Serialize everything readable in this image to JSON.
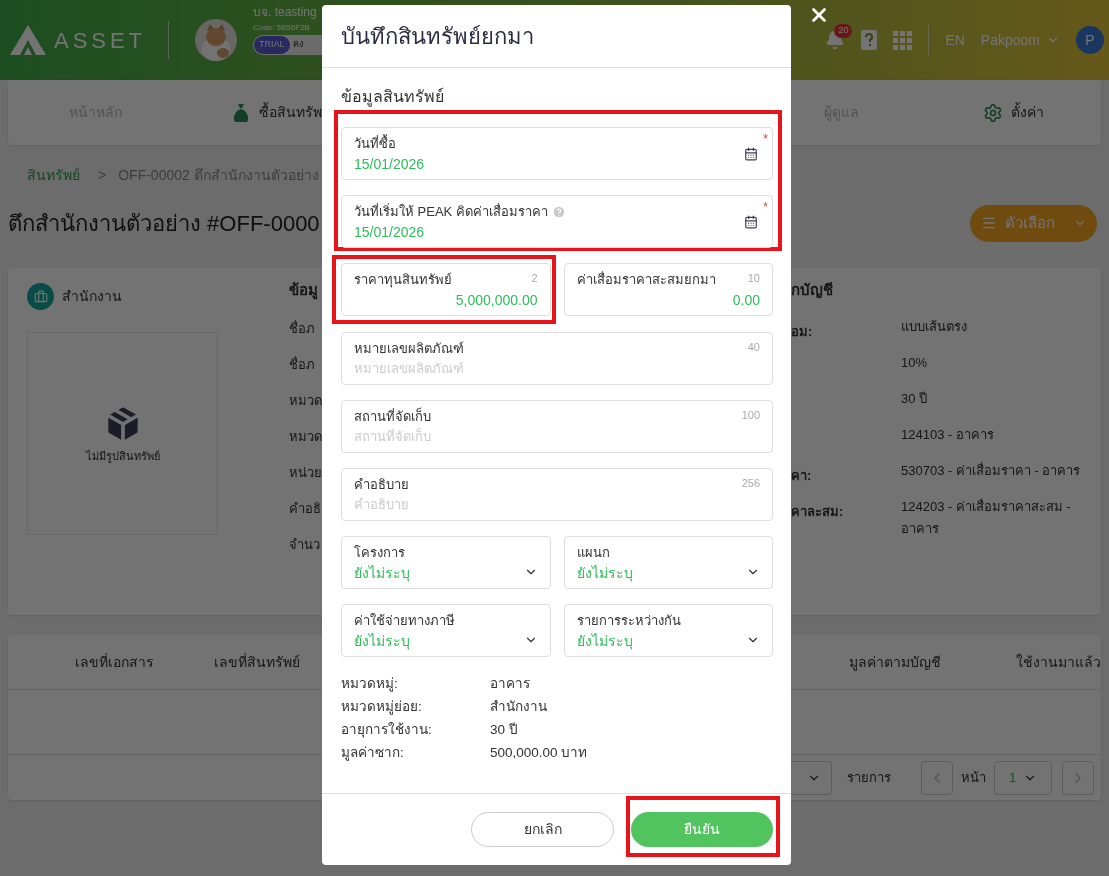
{
  "header": {
    "logo": "ASSET",
    "company": "บจ. teasting",
    "code": "Code: 5B56F2B",
    "badge": "TRIAL",
    "badge_note": "คง",
    "notifications": "20",
    "language": "EN",
    "user": "Pakpoom",
    "avatar": "P"
  },
  "nav": [
    {
      "label": "หน้าหลัก",
      "dimmed": true,
      "kind": "plain"
    },
    {
      "label": "ซื้อสินทรัพ",
      "dimmed": false,
      "kind": "money"
    },
    {
      "label": "ผู้ดูแล",
      "dimmed": true,
      "kind": "plain"
    },
    {
      "label": "ตั้งค่า",
      "dimmed": false,
      "kind": "settings"
    }
  ],
  "breadcrumb": {
    "link": "สินทรัพย์",
    "separator": ">",
    "current": "OFF-00002 ตึกสำนักงานตัวอย่าง"
  },
  "title": "ตึกสำนักงานตัวอย่าง #OFF-0000",
  "options_button": "ตัวเลือก",
  "asset_card": {
    "category": "สำนักงาน",
    "no_image": "ไม่มีรูปสินทรัพย์",
    "info_heading": "ข้อมู",
    "info_labels": [
      "ชื่อภ",
      "ชื่อภ",
      "หมวด",
      "หมวด",
      "หน่วย",
      "คำอธิ",
      "จำนว"
    ],
    "accounting_heading": "กบัญชี",
    "accounting_rows": [
      {
        "label": "อม:",
        "value": "แบบเส้นตรง"
      },
      {
        "value": "10%"
      },
      {
        "value": "30 ปี"
      },
      {
        "value": "124103 - อาคาร"
      },
      {
        "label": "คา:",
        "value": "530703 - ค่าเสื่อมราคา - อาคาร"
      },
      {
        "label": "คาละสม:",
        "value": "124203 - ค่าเสื่อมราคาสะสม - อาคาร"
      }
    ]
  },
  "history_table": {
    "columns_left": [
      "เลขที่เอกสาร",
      "เลขที่สินทรัพย์"
    ],
    "columns_right": [
      "มูลค่าตามบัญชี",
      "ใช้งานมาแล้ว"
    ],
    "rows_label": "รายการ",
    "page_label": "หน้า",
    "page": "1"
  },
  "modal": {
    "title": "บันทึกสินทรัพย์ยกมา",
    "section": "ข้อมูลสินทรัพย์",
    "date_group": {
      "highlighted": true,
      "fields": [
        {
          "label": "วันที่ซื้อ",
          "value": "15/01/2026",
          "required_mark": "*",
          "help": false
        },
        {
          "label": "วันที่เริ่มให้ PEAK คิดค่าเสื่อมราคา",
          "value": "15/01/2026",
          "required_mark": "*",
          "help": true
        }
      ]
    },
    "amount_fields": [
      {
        "label": "ราคาทุนสินทรัพย์",
        "counter": "2",
        "value": "5,000,000.00",
        "highlighted": true
      },
      {
        "label": "ค่าเสื่อมราคาสะสมยกมา",
        "counter": "10",
        "value": "0.00",
        "highlighted": false
      }
    ],
    "text_fields": [
      {
        "label": "หมายเลขผลิตภัณฑ์",
        "counter": "40",
        "placeholder": "หมายเลขผลิตภัณฑ์"
      },
      {
        "label": "สถานที่จัดเก็บ",
        "counter": "100",
        "placeholder": "สถานที่จัดเก็บ"
      },
      {
        "label": "คำอธิบาย",
        "counter": "256",
        "placeholder": "คำอธิบาย"
      }
    ],
    "select_fields": [
      {
        "label": "โครงการ",
        "value": "ยังไม่ระบุ"
      },
      {
        "label": "แผนก",
        "value": "ยังไม่ระบุ"
      },
      {
        "label": "ค่าใช้จ่ายทางภาษี",
        "value": "ยังไม่ระบุ"
      },
      {
        "label": "รายการระหว่างกัน",
        "value": "ยังไม่ระบุ"
      }
    ],
    "summary": [
      {
        "label": "หมวดหมู่:",
        "value": "อาคาร"
      },
      {
        "label": "หมวดหมู่ย่อย:",
        "value": "สำนักงาน"
      },
      {
        "label": "อายุการใช้งาน:",
        "value": "30 ปี"
      },
      {
        "label": "มูลค่าซาก:",
        "value": "500,000.00 บาท"
      }
    ],
    "cancel_button": "ยกเลิก",
    "confirm_button": {
      "label": "ยืนยัน",
      "highlighted": true
    }
  }
}
